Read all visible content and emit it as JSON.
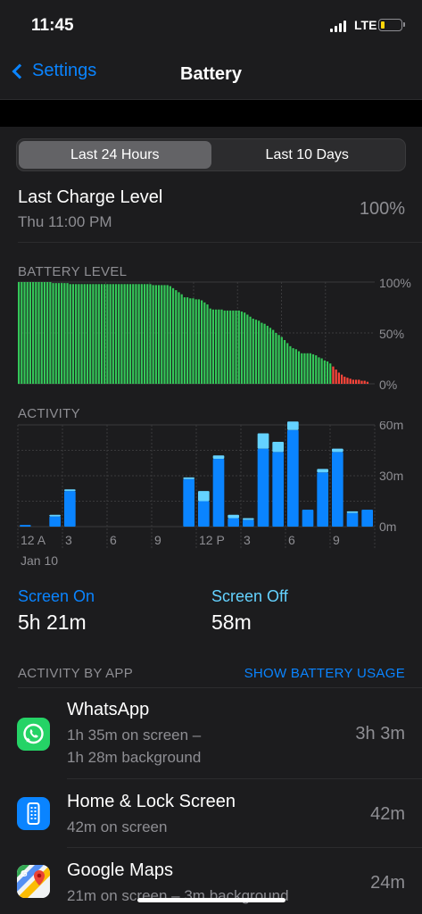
{
  "status": {
    "time": "11:45",
    "network": "LTE"
  },
  "nav": {
    "back_label": "Settings",
    "title": "Battery"
  },
  "segment": {
    "options": [
      "Last 24 Hours",
      "Last 10 Days"
    ],
    "selected": 0
  },
  "last_charge": {
    "label": "Last Charge Level",
    "time": "Thu 11:00 PM",
    "value": "100%"
  },
  "battery_level": {
    "label": "BATTERY LEVEL",
    "y_ticks": [
      "100%",
      "50%",
      "0%"
    ]
  },
  "activity": {
    "label": "ACTIVITY",
    "y_ticks": [
      "60m",
      "30m",
      "0m"
    ],
    "x_ticks": [
      "12 A",
      "3",
      "6",
      "9",
      "12 P",
      "3",
      "6",
      "9"
    ],
    "date_label": "Jan 10"
  },
  "screen_on": {
    "label": "Screen On",
    "value": "5h 21m"
  },
  "screen_off": {
    "label": "Screen Off",
    "value": "58m"
  },
  "activity_by_app": {
    "label": "ACTIVITY BY APP",
    "action": "SHOW BATTERY USAGE"
  },
  "apps": [
    {
      "name": "WhatsApp",
      "line1": "1h 35m on screen –",
      "line2": "1h 28m background",
      "time": "3h 3m"
    },
    {
      "name": "Home & Lock Screen",
      "line1": "42m on screen",
      "time": "42m"
    },
    {
      "name": "Google Maps",
      "line1": "21m on screen – 3m background",
      "time": "24m"
    }
  ],
  "chart_data": [
    {
      "type": "bar",
      "title": "BATTERY LEVEL",
      "ylim": [
        0,
        100
      ],
      "unit": "%",
      "values": [
        100,
        100,
        100,
        100,
        100,
        100,
        100,
        100,
        100,
        100,
        100,
        100,
        99,
        99,
        99,
        99,
        99,
        99,
        98,
        98,
        98,
        98,
        98,
        98,
        98,
        98,
        98,
        98,
        98,
        98,
        98,
        98,
        98,
        98,
        98,
        98,
        98,
        98,
        98,
        98,
        98,
        98,
        98,
        98,
        98,
        98,
        98,
        97,
        97,
        97,
        97,
        97,
        97,
        96,
        94,
        92,
        90,
        88,
        85,
        85,
        84,
        84,
        83,
        83,
        82,
        80,
        78,
        74,
        73,
        73,
        73,
        73,
        72,
        72,
        72,
        72,
        72,
        72,
        71,
        70,
        68,
        66,
        64,
        63,
        62,
        60,
        59,
        57,
        55,
        53,
        50,
        48,
        46,
        43,
        40,
        37,
        35,
        34,
        32,
        30,
        30,
        30,
        30,
        29,
        28,
        26,
        25,
        23,
        22,
        20,
        17,
        14,
        11,
        9,
        7,
        6,
        5,
        4,
        4,
        4,
        3,
        3,
        2
      ],
      "colors": {
        "normal": "#34c759",
        "low": "#ff453a",
        "low_threshold": 20
      }
    },
    {
      "type": "bar",
      "title": "ACTIVITY",
      "ylim": [
        0,
        60
      ],
      "unit": "minutes",
      "categories": [
        "12 A",
        "1",
        "2",
        "3",
        "4",
        "5",
        "6",
        "7",
        "8",
        "9",
        "10",
        "11",
        "12 P",
        "1",
        "2",
        "3",
        "4",
        "5",
        "6",
        "7",
        "8",
        "9",
        "10",
        "11"
      ],
      "series": [
        {
          "name": "Screen On",
          "color": "#0a84ff",
          "values": [
            1,
            0,
            6,
            21,
            0,
            0,
            0,
            0,
            0,
            0,
            0,
            28,
            15,
            40,
            5,
            4,
            46,
            44,
            57,
            10,
            32,
            44,
            8,
            10
          ]
        },
        {
          "name": "Screen Off",
          "color": "#64d2ff",
          "values": [
            0,
            0,
            1,
            1,
            0,
            0,
            0,
            0,
            0,
            0,
            0,
            1,
            6,
            2,
            2,
            1,
            9,
            6,
            5,
            0,
            2,
            2,
            1,
            0
          ]
        }
      ]
    }
  ]
}
